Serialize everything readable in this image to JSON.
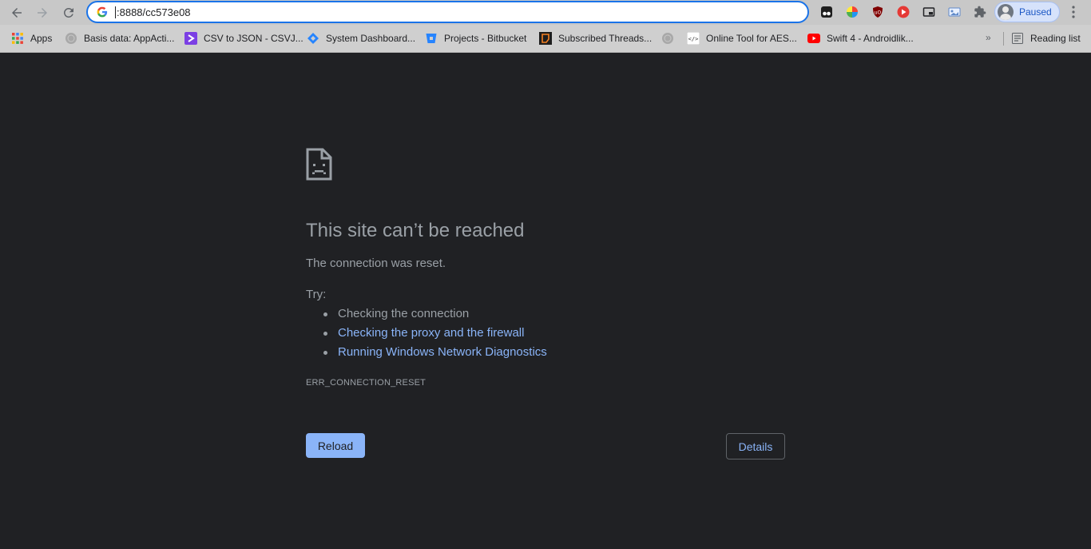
{
  "toolbar": {
    "url": ":8888/cc573e08",
    "profile_label": "Paused"
  },
  "bookmarks": {
    "items": [
      {
        "label": "Apps",
        "icon": "apps-grid-icon"
      },
      {
        "label": "Basis data: AppActi...",
        "icon": "globe-icon"
      },
      {
        "label": "CSV to JSON - CSVJ...",
        "icon": "csvjson-icon"
      },
      {
        "label": "System Dashboard...",
        "icon": "jira-icon"
      },
      {
        "label": "Projects - Bitbucket",
        "icon": "bitbucket-icon"
      },
      {
        "label": "Subscribed Threads...",
        "icon": "forum-icon"
      },
      {
        "label": "",
        "icon": "globe-icon"
      },
      {
        "label": "Online Tool for AES...",
        "icon": "code-tag-icon"
      },
      {
        "label": "Swift 4 - Androidlik...",
        "icon": "youtube-icon"
      }
    ],
    "overflow": "»",
    "reading_list": "Reading list"
  },
  "error": {
    "title": "This site can’t be reached",
    "description": "The connection was reset.",
    "try_label": "Try:",
    "suggestions": [
      {
        "text": "Checking the connection"
      },
      {
        "text": "Checking the proxy and the firewall"
      },
      {
        "text": "Running Windows Network Diagnostics"
      }
    ],
    "code": "ERR_CONNECTION_RESET",
    "reload_label": "Reload",
    "details_label": "Details"
  },
  "colors": {
    "page_background": "#202124",
    "text": "#9aa0a6",
    "link": "#8ab4f8",
    "accent": "#1a73e8"
  }
}
